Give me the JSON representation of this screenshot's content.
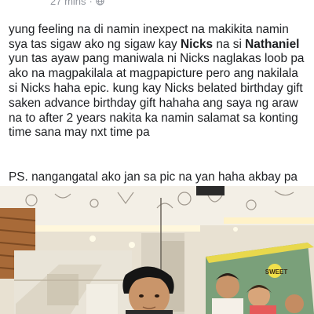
{
  "post": {
    "timestamp": "27 mins",
    "dot": "·",
    "privacy_icon": "globe-icon",
    "text_part1": "yung feeling na di namin inexpect na makikita namin sya tas sigaw ako ng sigaw kay ",
    "mention1": "Nicks",
    "text_part2": " na si ",
    "mention2": "Nathaniel",
    "text_part3": " yun tas ayaw pang maniwala ni Nicks naglakas loob pa ako na magpakilala at magpapicture pero ang nakilala si Nicks haha epic. kung kay Nicks belated birthday gift saken advance birthday gift hahaha ang saya ng araw na to after 2 years nakita ka namin salamat sa konting time sana may nxt time pa",
    "ps_text": "PS. nangangatal ako jan sa pic na yan haha akbay pa more Nate pero yung towel ang nagdala"
  },
  "photo": {
    "shop_sign_text": "SWEET",
    "colors": {
      "ceiling": "#f3efe6",
      "wood": "#a86a38",
      "shelf": "#e9e4d8",
      "poster": "#7aa07a",
      "skin": "#c9956a",
      "hair": "#151515",
      "light": "#fff7dc"
    }
  }
}
